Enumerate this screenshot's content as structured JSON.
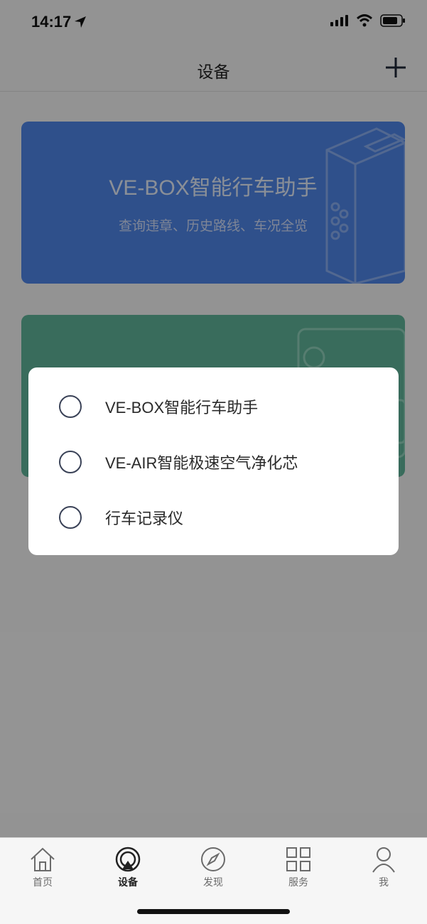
{
  "status_bar": {
    "time": "14:17"
  },
  "nav": {
    "title": "设备",
    "add_icon": "plus-icon"
  },
  "cards": [
    {
      "title": "VE-BOX智能行车助手",
      "subtitle": "查询违章、历史路线、车况全览",
      "color": "#4f86e8"
    },
    {
      "title": "",
      "subtitle": "",
      "color": "#5fb499"
    }
  ],
  "dialog": {
    "options": [
      {
        "label": "VE-BOX智能行车助手"
      },
      {
        "label": "VE-AIR智能极速空气净化芯"
      },
      {
        "label": "行车记录仪"
      }
    ]
  },
  "tabs": [
    {
      "label": "首页",
      "icon": "home-icon",
      "active": false
    },
    {
      "label": "设备",
      "icon": "device-icon",
      "active": true
    },
    {
      "label": "发现",
      "icon": "compass-icon",
      "active": false
    },
    {
      "label": "服务",
      "icon": "grid-icon",
      "active": false
    },
    {
      "label": "我",
      "icon": "profile-icon",
      "active": false
    }
  ]
}
